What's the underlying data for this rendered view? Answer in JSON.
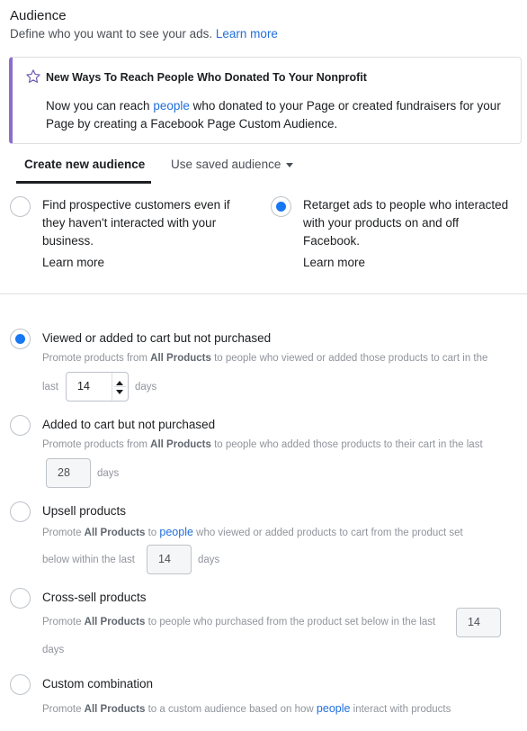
{
  "header": {
    "title": "Audience",
    "subtitle": "Define who you want to see your ads.",
    "learn_more": "Learn more"
  },
  "notice": {
    "icon": "star-outline-icon",
    "accent_color": "#8b6fcb",
    "title": "New Ways To Reach People Who Donated To Your Nonprofit",
    "body_before": "Now you can reach ",
    "body_link": "people",
    "body_after": " who donated to your Page or created fundraisers for your Page by creating a Facebook Page Custom Audience."
  },
  "tabs": {
    "create": "Create new audience",
    "saved": "Use saved audience"
  },
  "audience_types": [
    {
      "label": "Find prospective customers even if they haven't interacted with your business.",
      "learn_more": "Learn more",
      "selected": false
    },
    {
      "label": "Retarget ads to people who interacted with your products on and off Facebook.",
      "learn_more": "Learn more",
      "selected": true
    }
  ],
  "retarget_options": [
    {
      "label": "Viewed or added to cart but not purchased",
      "selected": true,
      "desc_1": "Promote products from ",
      "desc_bold": "All Products",
      "desc_2": " to people who viewed or added those products to cart in the",
      "pre": "last",
      "days_value": "14",
      "days_unit": "days"
    },
    {
      "label": "Added to cart but not purchased",
      "selected": false,
      "desc_1": "Promote products from ",
      "desc_bold": "All Products",
      "desc_2": " to people who added those products to their cart in the last",
      "days_value": "28",
      "days_unit": "days"
    },
    {
      "label": "Upsell products",
      "selected": false,
      "desc_1": "Promote ",
      "desc_bold": "All Products",
      "desc_mid": " to ",
      "desc_link": "people",
      "desc_2": " who viewed or added products to cart from the product set",
      "pre": "below within the last",
      "days_value": "14",
      "days_unit": "days"
    },
    {
      "label": "Cross-sell products",
      "selected": false,
      "desc_1": "Promote ",
      "desc_bold": "All Products",
      "desc_2": " to people who purchased from the product set below in the last",
      "days_value": "14",
      "days_unit": "days"
    },
    {
      "label": "Custom combination",
      "selected": false,
      "desc_1": "Promote ",
      "desc_bold": "All Products",
      "desc_2": " to a custom audience based on how ",
      "desc_link": "people",
      "desc_3": " interact with products"
    }
  ],
  "colors": {
    "link": "#216fdb",
    "radio_selected": "#1877f2"
  }
}
